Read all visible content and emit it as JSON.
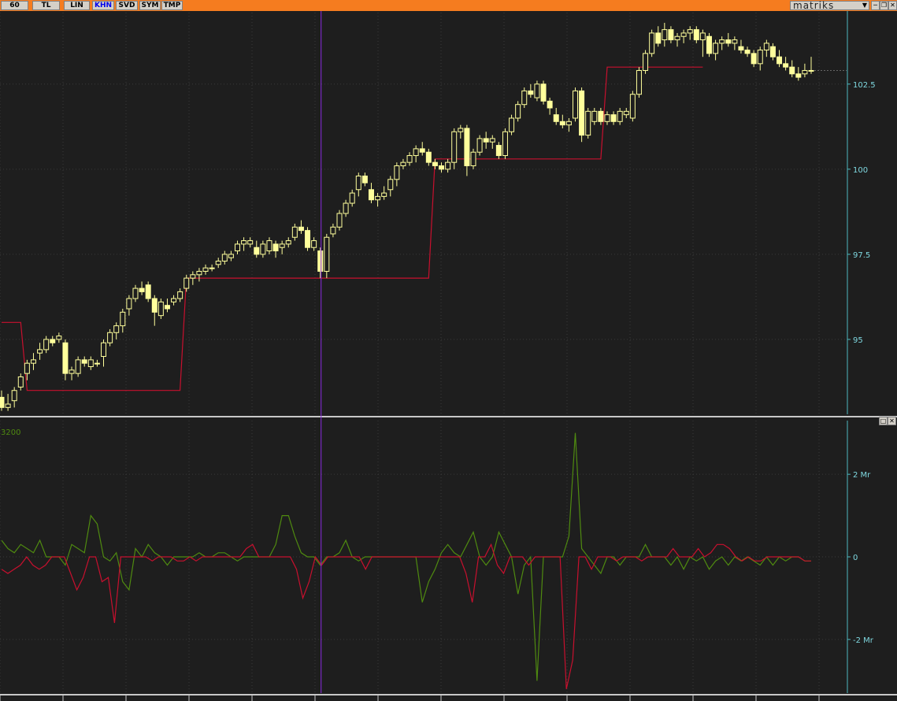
{
  "toolbar": {
    "buttons": [
      {
        "label": "60",
        "active": false
      },
      {
        "label": "TL",
        "active": false
      },
      {
        "label": "LIN",
        "active": false
      },
      {
        "label": "KHN",
        "active": true
      },
      {
        "label": "SVD",
        "active": false
      },
      {
        "label": "SYM",
        "active": false
      },
      {
        "label": "TMP",
        "active": false
      }
    ],
    "brand": "matriks",
    "dropdown_icon": "triangle-down",
    "window_controls": [
      "minimize-icon",
      "restore-icon",
      "close-icon"
    ],
    "accent_color": "#f57c1f"
  },
  "indicator_pane": {
    "label": "3200",
    "controls": [
      "maximize-icon",
      "close-icon"
    ]
  },
  "colors": {
    "background": "#1e1e1e",
    "candle": "#ffff9c",
    "stop_line": "#c8102e",
    "positive_flow": "#4f8a10",
    "negative_flow": "#c8102e",
    "cursor_line": "#8a2be2",
    "axis_text": "#7fd8e0"
  },
  "chart_data": [
    {
      "type": "candlestick",
      "title": "",
      "y_ticks": [
        95,
        97.5,
        100,
        102.5
      ],
      "y_tick_labels": [
        "95",
        "97.5",
        "100",
        "102.5"
      ],
      "ylim": [
        92.8,
        104.6
      ],
      "grid": true,
      "candles": [
        [
          93.3,
          93.5,
          92.9,
          93.0
        ],
        [
          93.0,
          93.4,
          92.9,
          93.1
        ],
        [
          93.2,
          93.6,
          93.0,
          93.5
        ],
        [
          93.6,
          94.0,
          93.5,
          93.9
        ],
        [
          94.0,
          94.4,
          93.8,
          94.3
        ],
        [
          94.3,
          94.6,
          94.1,
          94.4
        ],
        [
          94.6,
          94.9,
          94.4,
          94.7
        ],
        [
          94.7,
          95.1,
          94.6,
          95.0
        ],
        [
          95.0,
          95.1,
          94.8,
          94.9
        ],
        [
          95.0,
          95.2,
          94.9,
          95.1
        ],
        [
          94.9,
          95.0,
          93.8,
          94.0
        ],
        [
          94.0,
          94.2,
          93.8,
          94.1
        ],
        [
          94.0,
          94.5,
          93.9,
          94.4
        ],
        [
          94.4,
          94.5,
          94.2,
          94.3
        ],
        [
          94.2,
          94.5,
          94.1,
          94.4
        ],
        [
          94.3,
          94.4,
          94.2,
          94.3
        ],
        [
          94.5,
          95.0,
          94.2,
          94.9
        ],
        [
          94.9,
          95.3,
          94.8,
          95.2
        ],
        [
          95.2,
          95.5,
          95.0,
          95.4
        ],
        [
          95.4,
          95.9,
          95.2,
          95.8
        ],
        [
          95.9,
          96.3,
          95.7,
          96.2
        ],
        [
          96.2,
          96.6,
          96.1,
          96.5
        ],
        [
          96.5,
          96.7,
          96.3,
          96.4
        ],
        [
          96.6,
          96.7,
          96.1,
          96.2
        ],
        [
          96.2,
          96.3,
          95.4,
          95.8
        ],
        [
          95.7,
          96.2,
          95.6,
          96.1
        ],
        [
          96.0,
          96.2,
          95.8,
          95.9
        ],
        [
          96.1,
          96.3,
          96.0,
          96.2
        ],
        [
          96.2,
          96.5,
          96.1,
          96.4
        ],
        [
          96.5,
          96.9,
          96.4,
          96.8
        ],
        [
          96.8,
          97.0,
          96.6,
          96.9
        ],
        [
          96.9,
          97.1,
          96.7,
          97.0
        ],
        [
          97.0,
          97.2,
          96.9,
          97.1
        ],
        [
          97.1,
          97.2,
          97.0,
          97.1
        ],
        [
          97.2,
          97.4,
          97.1,
          97.3
        ],
        [
          97.3,
          97.6,
          97.2,
          97.5
        ],
        [
          97.4,
          97.6,
          97.3,
          97.5
        ],
        [
          97.6,
          97.9,
          97.5,
          97.8
        ],
        [
          97.8,
          98.0,
          97.6,
          97.9
        ],
        [
          97.8,
          98.0,
          97.7,
          97.9
        ],
        [
          97.7,
          97.9,
          97.4,
          97.5
        ],
        [
          97.5,
          97.9,
          97.4,
          97.8
        ],
        [
          97.6,
          98.0,
          97.5,
          97.9
        ],
        [
          97.8,
          97.9,
          97.4,
          97.6
        ],
        [
          97.7,
          97.9,
          97.5,
          97.8
        ],
        [
          97.8,
          98.0,
          97.7,
          97.9
        ],
        [
          98.0,
          98.4,
          97.9,
          98.3
        ],
        [
          98.3,
          98.5,
          98.1,
          98.2
        ],
        [
          98.2,
          98.3,
          97.6,
          97.7
        ],
        [
          97.7,
          98.0,
          97.6,
          97.9
        ],
        [
          97.6,
          97.7,
          96.8,
          97.0
        ],
        [
          97.0,
          98.1,
          96.8,
          98.0
        ],
        [
          98.1,
          98.4,
          98.0,
          98.3
        ],
        [
          98.3,
          98.8,
          98.2,
          98.7
        ],
        [
          98.7,
          99.1,
          98.6,
          99.0
        ],
        [
          99.0,
          99.4,
          98.9,
          99.3
        ],
        [
          99.4,
          99.9,
          99.2,
          99.8
        ],
        [
          99.8,
          99.9,
          99.5,
          99.6
        ],
        [
          99.4,
          99.6,
          99.0,
          99.1
        ],
        [
          99.1,
          99.3,
          98.9,
          99.2
        ],
        [
          99.2,
          99.5,
          99.1,
          99.3
        ],
        [
          99.4,
          99.8,
          99.2,
          99.7
        ],
        [
          99.7,
          100.2,
          99.5,
          100.1
        ],
        [
          100.1,
          100.3,
          100.0,
          100.2
        ],
        [
          100.2,
          100.5,
          100.1,
          100.4
        ],
        [
          100.4,
          100.7,
          100.2,
          100.6
        ],
        [
          100.6,
          100.8,
          100.4,
          100.5
        ],
        [
          100.5,
          100.6,
          100.1,
          100.2
        ],
        [
          100.2,
          100.3,
          100.0,
          100.1
        ],
        [
          100.1,
          100.2,
          99.9,
          100.0
        ],
        [
          100.0,
          100.3,
          99.9,
          100.2
        ],
        [
          100.2,
          101.2,
          100.0,
          101.1
        ],
        [
          101.1,
          101.3,
          100.9,
          101.2
        ],
        [
          101.2,
          101.3,
          99.8,
          100.1
        ],
        [
          100.1,
          100.6,
          100.0,
          100.5
        ],
        [
          100.5,
          101.0,
          100.4,
          100.9
        ],
        [
          100.9,
          101.1,
          100.6,
          100.8
        ],
        [
          100.8,
          101.0,
          100.6,
          100.9
        ],
        [
          100.7,
          100.8,
          100.3,
          100.4
        ],
        [
          100.4,
          101.2,
          100.3,
          101.1
        ],
        [
          101.1,
          101.6,
          101.0,
          101.5
        ],
        [
          101.5,
          102.0,
          101.4,
          101.9
        ],
        [
          101.9,
          102.4,
          101.8,
          102.3
        ],
        [
          102.3,
          102.5,
          102.1,
          102.2
        ],
        [
          102.1,
          102.6,
          102.0,
          102.5
        ],
        [
          102.5,
          102.6,
          101.9,
          102.0
        ],
        [
          102.0,
          102.1,
          101.6,
          101.8
        ],
        [
          101.6,
          101.8,
          101.3,
          101.4
        ],
        [
          101.4,
          101.6,
          101.2,
          101.3
        ],
        [
          101.3,
          101.5,
          101.1,
          101.4
        ],
        [
          101.5,
          102.4,
          101.4,
          102.3
        ],
        [
          102.3,
          102.4,
          100.8,
          101.0
        ],
        [
          101.0,
          101.8,
          100.9,
          101.7
        ],
        [
          101.4,
          101.8,
          101.3,
          101.7
        ],
        [
          101.7,
          101.8,
          101.3,
          101.4
        ],
        [
          101.4,
          101.7,
          101.3,
          101.6
        ],
        [
          101.6,
          101.7,
          101.3,
          101.4
        ],
        [
          101.4,
          101.8,
          101.3,
          101.7
        ],
        [
          101.6,
          101.8,
          101.5,
          101.7
        ],
        [
          101.5,
          102.3,
          101.4,
          102.2
        ],
        [
          102.2,
          103.0,
          102.1,
          102.9
        ],
        [
          102.9,
          103.5,
          102.8,
          103.4
        ],
        [
          103.4,
          104.1,
          103.3,
          104.0
        ],
        [
          104.0,
          104.2,
          103.6,
          103.7
        ],
        [
          103.8,
          104.3,
          103.6,
          104.1
        ],
        [
          104.1,
          104.2,
          103.7,
          103.8
        ],
        [
          103.8,
          104.0,
          103.6,
          103.9
        ],
        [
          103.9,
          104.1,
          103.7,
          104.0
        ],
        [
          104.0,
          104.2,
          103.8,
          104.1
        ],
        [
          104.1,
          104.2,
          103.7,
          103.8
        ],
        [
          103.8,
          104.1,
          103.3,
          104.0
        ],
        [
          103.9,
          104.0,
          103.3,
          103.4
        ],
        [
          103.4,
          103.8,
          103.2,
          103.7
        ],
        [
          103.7,
          103.9,
          103.5,
          103.8
        ],
        [
          103.8,
          104.0,
          103.6,
          103.7
        ],
        [
          103.7,
          103.9,
          103.5,
          103.8
        ],
        [
          103.6,
          103.8,
          103.4,
          103.5
        ],
        [
          103.5,
          103.6,
          103.3,
          103.4
        ],
        [
          103.4,
          103.5,
          103.0,
          103.1
        ],
        [
          103.1,
          103.6,
          102.9,
          103.5
        ],
        [
          103.5,
          103.8,
          103.3,
          103.7
        ],
        [
          103.6,
          103.7,
          103.2,
          103.3
        ],
        [
          103.3,
          103.5,
          103.0,
          103.1
        ],
        [
          103.1,
          103.3,
          102.9,
          103.0
        ],
        [
          103.0,
          103.2,
          102.7,
          102.8
        ],
        [
          102.8,
          103.0,
          102.6,
          102.7
        ],
        [
          102.8,
          103.1,
          102.7,
          102.9
        ],
        [
          102.9,
          103.3,
          102.8,
          102.9
        ]
      ],
      "stop_line": [
        [
          0,
          95.5
        ],
        [
          3,
          95.5
        ],
        [
          4,
          93.5
        ],
        [
          28,
          93.5
        ],
        [
          29,
          96.8
        ],
        [
          43,
          96.8
        ],
        [
          44,
          96.8
        ],
        [
          67,
          96.8
        ],
        [
          68,
          100.3
        ],
        [
          82,
          100.3
        ],
        [
          83,
          100.3
        ],
        [
          94,
          100.3
        ],
        [
          95,
          103.0
        ],
        [
          108,
          103.0
        ],
        [
          109,
          103.0
        ],
        [
          110,
          103.0
        ]
      ],
      "cursor_index": 50
    },
    {
      "type": "line",
      "y_ticks": [
        -2,
        0,
        2
      ],
      "y_tick_labels": [
        "-2 Mr",
        "0",
        "2 Mr"
      ],
      "ylim": [
        -3.3,
        3.3
      ],
      "grid": true,
      "series": [
        {
          "color": "#4f8a10",
          "values": [
            0.4,
            0.2,
            0.1,
            0.3,
            0.2,
            0.1,
            0.4,
            0.0,
            0.0,
            0.0,
            -0.2,
            0.3,
            0.2,
            0.1,
            1.0,
            0.8,
            0.0,
            -0.1,
            0.1,
            -0.6,
            -0.8,
            0.2,
            0.0,
            0.3,
            0.1,
            0.0,
            -0.2,
            0.0,
            0.0,
            0.0,
            0.0,
            0.1,
            0.0,
            0.0,
            0.1,
            0.1,
            0.0,
            -0.1,
            0.0,
            0.0,
            0.0,
            0.0,
            0.0,
            0.3,
            1.0,
            1.0,
            0.5,
            0.1,
            0.0,
            0.0,
            -0.2,
            0.0,
            0.0,
            0.1,
            0.4,
            0.0,
            -0.1,
            0.0,
            0.0,
            0.0,
            0.0,
            0.0,
            0.0,
            0.0,
            0.0,
            0.0,
            -1.1,
            -0.6,
            -0.3,
            0.1,
            0.3,
            0.1,
            0.0,
            0.3,
            0.6,
            0.0,
            -0.2,
            0.0,
            0.6,
            0.3,
            0.0,
            -0.9,
            -0.2,
            0.0,
            -3.0,
            0.0,
            0.0,
            0.0,
            0.0,
            0.5,
            3.0,
            0.2,
            0.0,
            -0.2,
            -0.4,
            0.0,
            0.0,
            -0.2,
            0.0,
            0.0,
            0.0,
            0.3,
            0.0,
            0.0,
            0.0,
            -0.2,
            0.0,
            -0.3,
            0.0,
            -0.1,
            0.0,
            -0.3,
            -0.1,
            0.0,
            -0.2,
            0.0,
            -0.1,
            0.0,
            -0.1,
            -0.2,
            0.0,
            -0.2,
            0.0,
            -0.1,
            0.0,
            0.0,
            -0.1,
            -0.1
          ]
        },
        {
          "color": "#c8102e",
          "values": [
            -0.3,
            -0.4,
            -0.3,
            -0.2,
            0.0,
            -0.2,
            -0.3,
            -0.2,
            0.0,
            0.0,
            0.0,
            -0.4,
            -0.8,
            -0.5,
            0.0,
            0.0,
            -0.6,
            -0.5,
            -1.6,
            0.0,
            0.0,
            0.0,
            0.0,
            0.0,
            -0.1,
            0.0,
            0.0,
            0.0,
            -0.1,
            -0.1,
            0.0,
            -0.1,
            0.0,
            0.0,
            0.0,
            0.0,
            0.0,
            0.0,
            0.0,
            0.2,
            0.3,
            0.0,
            0.0,
            0.0,
            0.0,
            0.0,
            0.0,
            -0.3,
            -1.0,
            -0.6,
            0.0,
            -0.2,
            0.0,
            0.0,
            0.0,
            0.0,
            0.0,
            0.0,
            -0.3,
            0.0,
            0.0,
            0.0,
            0.0,
            0.0,
            0.0,
            0.0,
            0.0,
            0.0,
            0.0,
            0.0,
            0.0,
            0.0,
            0.0,
            0.0,
            -0.4,
            -1.1,
            0.0,
            0.0,
            0.3,
            -0.2,
            -0.4,
            0.0,
            0.0,
            0.0,
            -0.2,
            0.0,
            0.0,
            0.0,
            0.0,
            0.0,
            -3.2,
            -2.5,
            0.0,
            0.0,
            -0.3,
            0.0,
            0.0,
            0.0,
            -0.1,
            0.0,
            0.0,
            0.0,
            -0.1,
            0.0,
            0.0,
            0.0,
            0.0,
            0.2,
            0.0,
            0.0,
            0.0,
            0.2,
            0.0,
            0.1,
            0.3,
            0.3,
            0.2,
            0.0,
            -0.1,
            0.0,
            -0.1,
            -0.1,
            0.0,
            0.0,
            0.0,
            0.0,
            0.0,
            0.0,
            -0.1,
            -0.1
          ]
        }
      ]
    }
  ]
}
